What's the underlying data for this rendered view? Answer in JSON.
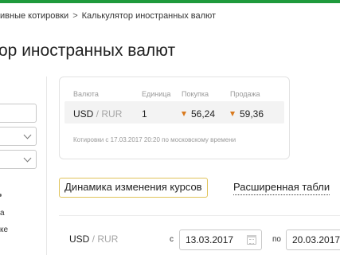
{
  "breadcrumb": {
    "items": [
      "ивные котировки",
      "Калькулятор иностранных валют"
    ],
    "separator": ">"
  },
  "page": {
    "title": "ор иностранных валют"
  },
  "left_panel": {
    "fragments": [
      "а",
      "ке"
    ]
  },
  "rates": {
    "headers": {
      "currency": "Валюта",
      "unit": "Единица",
      "buy": "Покупка",
      "sell": "Продажа"
    },
    "row": {
      "currency_base": "USD",
      "currency_sep": " / ",
      "currency_quote": "RUR",
      "unit": "1",
      "buy": "56,24",
      "sell": "59,36",
      "buy_trend": "down",
      "sell_trend": "down"
    },
    "note": "Котировки с 17.03.2017 20:20 по московскому времени"
  },
  "tabs": {
    "active": "Динамика изменения курсов",
    "other": "Расширенная табли"
  },
  "dynamics": {
    "pair_base": "USD",
    "pair_sep": " / ",
    "pair_quote": "RUR",
    "from_label": "с",
    "from_value": "13.03.2017",
    "to_label": "по",
    "to_value": "20.03.2017"
  },
  "colors": {
    "brand_green": "#1f9a3c",
    "trend_down": "#d97a1e",
    "tab_border": "#e0c35a"
  }
}
